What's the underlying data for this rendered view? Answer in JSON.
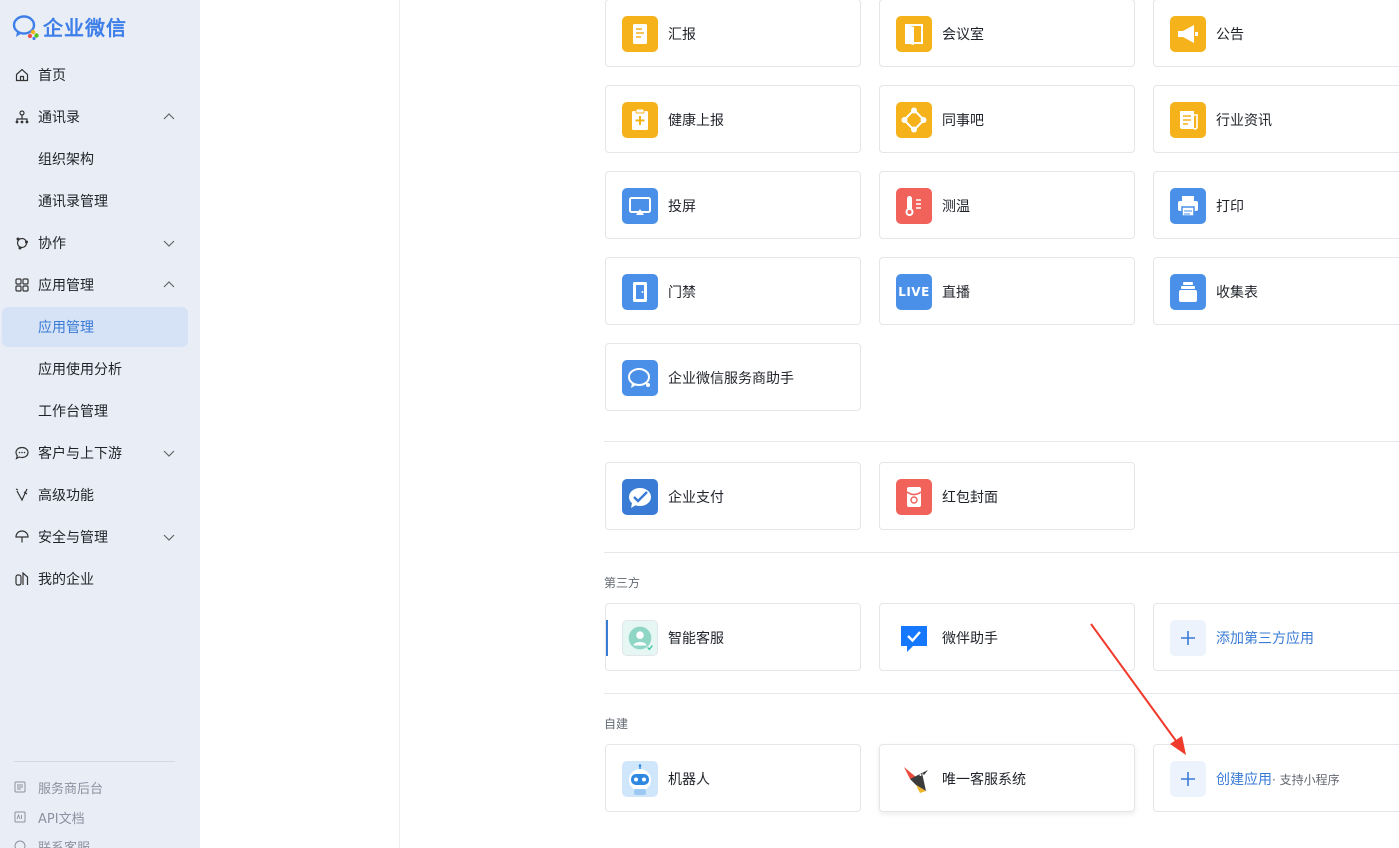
{
  "brand": {
    "name": "企业微信"
  },
  "sidebar": {
    "items": [
      {
        "label": "首页",
        "icon": "home-icon"
      },
      {
        "label": "通讯录",
        "icon": "org-icon",
        "chevron": "up"
      },
      {
        "label": "组织架构",
        "sub": true
      },
      {
        "label": "通讯录管理",
        "sub": true
      },
      {
        "label": "协作",
        "icon": "collab-icon",
        "chevron": "down"
      },
      {
        "label": "应用管理",
        "icon": "apps-icon",
        "chevron": "up"
      },
      {
        "label": "应用管理",
        "sub": true,
        "active": true
      },
      {
        "label": "应用使用分析",
        "sub": true
      },
      {
        "label": "工作台管理",
        "sub": true
      },
      {
        "label": "客户与上下游",
        "icon": "chat-icon",
        "chevron": "down"
      },
      {
        "label": "高级功能",
        "icon": "magic-icon"
      },
      {
        "label": "安全与管理",
        "icon": "umbrella-icon",
        "chevron": "down"
      },
      {
        "label": "我的企业",
        "icon": "building-icon"
      }
    ],
    "bottom": [
      {
        "label": "服务商后台",
        "icon": "service-icon"
      },
      {
        "label": "API文档",
        "icon": "api-icon"
      },
      {
        "label": "联系客服",
        "icon": "support-icon"
      }
    ]
  },
  "apps": {
    "row1": [
      "汇报",
      "会议室",
      "公告"
    ],
    "row2": [
      "健康上报",
      "同事吧",
      "行业资讯"
    ],
    "row3": [
      "投屏",
      "测温",
      "打印"
    ],
    "row4": [
      "门禁",
      "直播",
      "收集表"
    ],
    "row5": [
      "企业微信服务商助手"
    ],
    "payment": [
      "企业支付",
      "红包封面"
    ]
  },
  "third_party": {
    "label": "第三方",
    "items": [
      "智能客服",
      "微伴助手"
    ],
    "add_label": "添加第三方应用"
  },
  "self_built": {
    "label": "自建",
    "items": [
      "机器人",
      "唯一客服系统"
    ],
    "create_label": "创建应用",
    "create_sub": "· 支持小程序"
  },
  "live_badge": "LIVE",
  "colors": {
    "accent": "#3a7bd5",
    "yellow": "#f5b21b",
    "blue": "#4a90e8",
    "red": "#f0625a",
    "sidebar_bg": "#e9eef6"
  }
}
